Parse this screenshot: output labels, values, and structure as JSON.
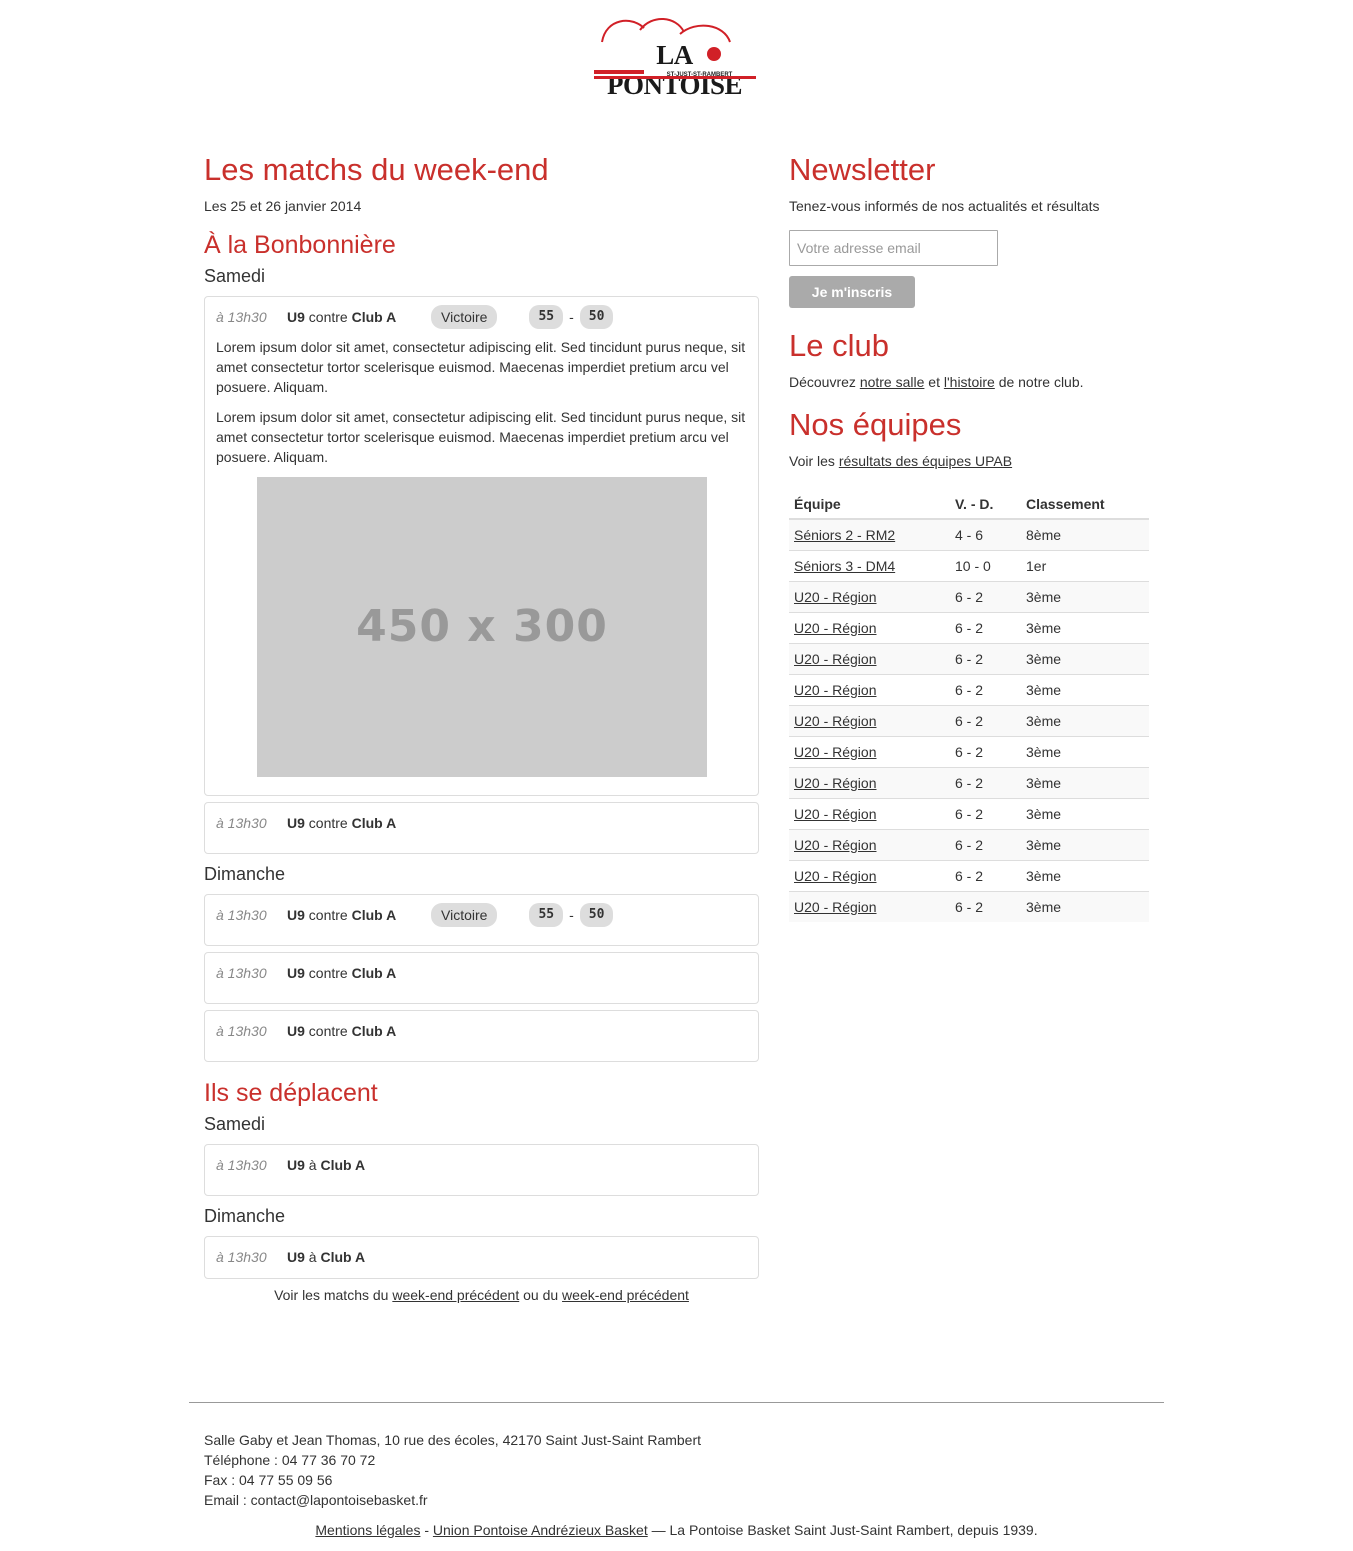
{
  "logo": {
    "title": "LA PONTOISE",
    "subtitle": "ST-JUST-ST-RAMBERT"
  },
  "main": {
    "title": "Les matchs du week-end",
    "date": "Les 25 et 26 janvier 2014",
    "home": {
      "title": "À la Bonbonnière",
      "saturday_label": "Samedi",
      "sunday_label": "Dimanche",
      "sat_match1": {
        "time": "à 13h30",
        "team": "U9",
        "connector": "contre",
        "opponent": "Club A",
        "result": "Victoire",
        "score_home": "55",
        "score_sep": "-",
        "score_away": "50",
        "paragraphs": [
          "Lorem ipsum dolor sit amet, consectetur adipiscing elit. Sed tincidunt purus neque, sit amet consectetur tortor scelerisque euismod. Maecenas imperdiet pretium arcu vel posuere. Aliquam.",
          "Lorem ipsum dolor sit amet, consectetur adipiscing elit. Sed tincidunt purus neque, sit amet consectetur tortor scelerisque euismod. Maecenas imperdiet pretium arcu vel posuere. Aliquam."
        ],
        "image_label": "450 x 300"
      },
      "sat_match2": {
        "time": "à 13h30",
        "team": "U9",
        "connector": "contre",
        "opponent": "Club A"
      },
      "sun_match1": {
        "time": "à 13h30",
        "team": "U9",
        "connector": "contre",
        "opponent": "Club A",
        "result": "Victoire",
        "score_home": "55",
        "score_sep": "-",
        "score_away": "50"
      },
      "sun_match2": {
        "time": "à 13h30",
        "team": "U9",
        "connector": "contre",
        "opponent": "Club A"
      },
      "sun_match3": {
        "time": "à 13h30",
        "team": "U9",
        "connector": "contre",
        "opponent": "Club A"
      }
    },
    "away": {
      "title": "Ils se déplacent",
      "saturday_label": "Samedi",
      "sunday_label": "Dimanche",
      "sat_match1": {
        "time": "à 13h30",
        "team": "U9",
        "connector": "à",
        "opponent": "Club A"
      },
      "sun_match1": {
        "time": "à 13h30",
        "team": "U9",
        "connector": "à",
        "opponent": "Club A"
      }
    },
    "more": {
      "prefix": "Voir les matchs du",
      "link1": "week-end précédent",
      "middle": "ou du",
      "link2": "week-end précédent"
    }
  },
  "sidebar": {
    "newsletter": {
      "title": "Newsletter",
      "text": "Tenez-vous informés de nos actualités et résultats",
      "placeholder": "Votre adresse email",
      "button": "Je m'inscris"
    },
    "club": {
      "title": "Le club",
      "prefix": "Découvrez",
      "link1": "notre salle",
      "middle": "et",
      "link2": "l'histoire",
      "suffix": "de notre club."
    },
    "teams": {
      "title": "Nos équipes",
      "prefix": "Voir les",
      "link": "résultats des équipes UPAB",
      "headers": {
        "team": "Équipe",
        "record": "V. - D.",
        "rank": "Classement"
      },
      "rows": [
        {
          "team": "Séniors 2 - RM2",
          "record": "4 - 6",
          "rank": "8ème"
        },
        {
          "team": "Séniors 3 - DM4",
          "record": "10 - 0",
          "rank": "1er"
        },
        {
          "team": "U20 - Région",
          "record": "6 - 2",
          "rank": "3ème"
        },
        {
          "team": "U20 - Région",
          "record": "6 - 2",
          "rank": "3ème"
        },
        {
          "team": "U20 - Région",
          "record": "6 - 2",
          "rank": "3ème"
        },
        {
          "team": "U20 - Région",
          "record": "6 - 2",
          "rank": "3ème"
        },
        {
          "team": "U20 - Région",
          "record": "6 - 2",
          "rank": "3ème"
        },
        {
          "team": "U20 - Région",
          "record": "6 - 2",
          "rank": "3ème"
        },
        {
          "team": "U20 - Région",
          "record": "6 - 2",
          "rank": "3ème"
        },
        {
          "team": "U20 - Région",
          "record": "6 - 2",
          "rank": "3ème"
        },
        {
          "team": "U20 - Région",
          "record": "6 - 2",
          "rank": "3ème"
        },
        {
          "team": "U20 - Région",
          "record": "6 - 2",
          "rank": "3ème"
        },
        {
          "team": "U20 - Région",
          "record": "6 - 2",
          "rank": "3ème"
        }
      ]
    }
  },
  "footer": {
    "address": "Salle Gaby et Jean Thomas, 10 rue des écoles, 42170 Saint Just-Saint Rambert",
    "phone": "Téléphone : 04 77 36 70 72",
    "fax": "Fax : 04 77 55 09 56",
    "email": "Email : contact@lapontoisebasket.fr",
    "legal_link": "Mentions légales",
    "sep": "-",
    "union_link": "Union Pontoise Andrézieux Basket",
    "tagline": "— La Pontoise Basket Saint Just-Saint Rambert, depuis 1939."
  },
  "colors": {
    "accent": "#c9302c",
    "logo_red": "#d12027",
    "badge_bg": "#dddddd",
    "button_bg": "#aaaaaa"
  },
  "icons": {
    "logo_ball": "basketball-icon"
  }
}
